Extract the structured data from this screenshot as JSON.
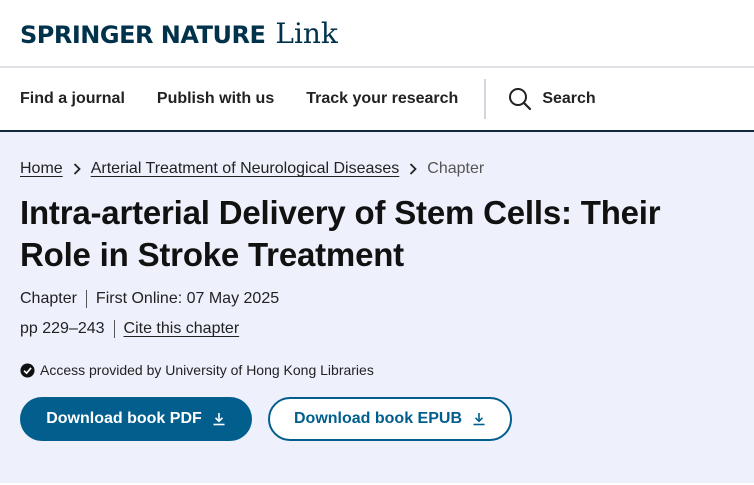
{
  "header": {
    "logo_brand": "SPRINGER NATURE",
    "logo_link": "Link"
  },
  "nav": {
    "items": [
      "Find a journal",
      "Publish with us",
      "Track your research"
    ],
    "search_label": "Search"
  },
  "breadcrumb": {
    "home": "Home",
    "book": "Arterial Treatment of Neurological Diseases",
    "current": "Chapter"
  },
  "article": {
    "title": "Intra-arterial Delivery of Stem Cells: Their Role in Stroke Treatment",
    "type": "Chapter",
    "first_online": "First Online: 07 May 2025",
    "pages": "pp 229–243",
    "cite_label": "Cite this chapter"
  },
  "access": {
    "text": "Access provided by University of Hong Kong Libraries"
  },
  "buttons": {
    "pdf_label": "Download book PDF",
    "epub_label": "Download book EPUB"
  },
  "colors": {
    "brand_navy": "#01324b",
    "button_blue": "#025e8d",
    "main_background": "#eef1fc"
  },
  "icons": [
    "search-icon",
    "chevron-right-icon",
    "check-circle-icon",
    "download-icon"
  ]
}
